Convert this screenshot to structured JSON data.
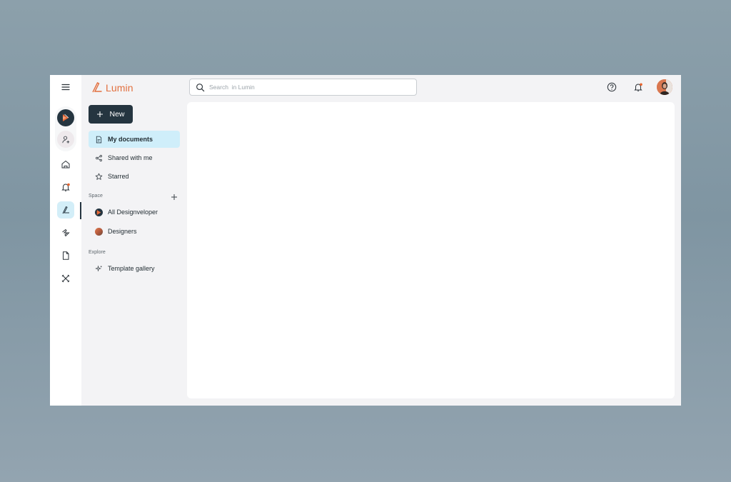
{
  "app": {
    "name": "Lumin",
    "accent": "#e2703f",
    "dark": "#253540",
    "highlight": "#cfeefa"
  },
  "rail": {
    "menu_icon": "hamburger-icon",
    "workspaces": [
      {
        "name": "designveloper-workspace",
        "color": "#253540"
      },
      {
        "name": "add-member",
        "icon": "person-add-icon"
      }
    ],
    "items": [
      {
        "name": "home",
        "icon": "home-icon"
      },
      {
        "name": "notifications",
        "icon": "bell-icon"
      },
      {
        "name": "lumin-docs",
        "icon": "lumin-logo-icon",
        "active": true
      },
      {
        "name": "automation",
        "icon": "zap-icon"
      },
      {
        "name": "documents",
        "icon": "file-icon"
      },
      {
        "name": "tools",
        "icon": "tools-icon"
      }
    ]
  },
  "sidebar": {
    "new_label": "New",
    "nav": [
      {
        "label": "My documents",
        "icon": "document-icon",
        "active": true
      },
      {
        "label": "Shared with me",
        "icon": "share-icon"
      },
      {
        "label": "Starred",
        "icon": "star-icon"
      }
    ],
    "space_label": "Space",
    "spaces": [
      {
        "label": "All Designveloper",
        "icon": "workspace-avatar"
      },
      {
        "label": "Designers",
        "icon": "user-avatar"
      }
    ],
    "explore_label": "Explore",
    "explore": [
      {
        "label": "Template gallery",
        "icon": "sparkle-icon"
      }
    ]
  },
  "header": {
    "search_placeholder": "Search  in Lumin",
    "help_icon": "help-icon",
    "bell_icon": "bell-icon",
    "notification_dot": "#e8622b"
  }
}
